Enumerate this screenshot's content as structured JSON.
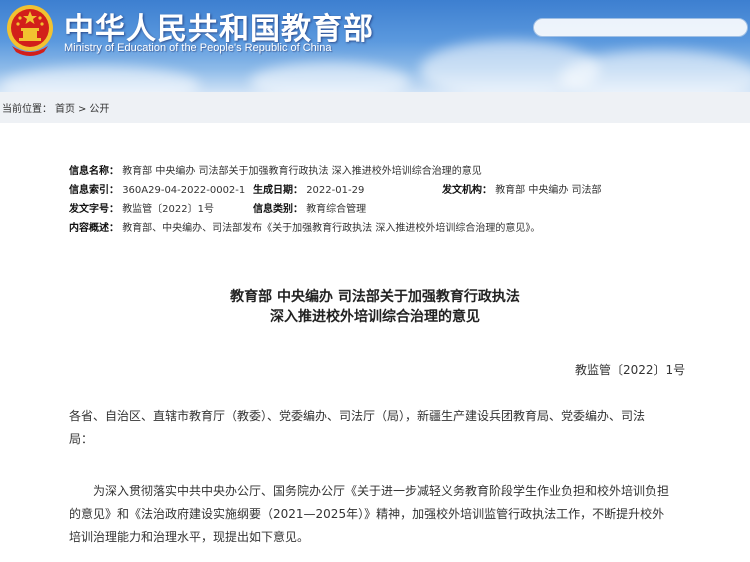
{
  "header": {
    "title": "中华人民共和国教育部",
    "subtitle": "Ministry of Education of the People's Republic of China",
    "search": {
      "placeholder": ""
    }
  },
  "breadcrumb": {
    "prefix": "当前位置：",
    "items": [
      "首页",
      "公开"
    ],
    "separator": ">"
  },
  "meta": {
    "name_label": "信息名称：",
    "name_value": "教育部 中央编办 司法部关于加强教育行政执法 深入推进校外培训综合治理的意见",
    "index_label": "信息索引：",
    "index_value": "360A29-04-2022-0002-1",
    "date_label": "生成日期：",
    "date_value": "2022-01-29",
    "issuer_label": "发文机构：",
    "issuer_value": "教育部 中央编办 司法部",
    "docno_label": "发文字号：",
    "docno_value": "教监管〔2022〕1号",
    "category_label": "信息类别：",
    "category_value": "教育综合管理",
    "summary_label": "内容概述：",
    "summary_value": "教育部、中央编办、司法部发布《关于加强教育行政执法 深入推进校外培训综合治理的意见》。"
  },
  "document": {
    "title_line1": "教育部 中央编办 司法部关于加强教育行政执法",
    "title_line2": "深入推进校外培训综合治理的意见",
    "number": "教监管〔2022〕1号",
    "addressee_line1": "各省、自治区、直辖市教育厅（教委）、党委编办、司法厅（局），新疆生产建设兵团教育局、党委编办、司法",
    "addressee_line2": "局：",
    "para1_line1": "为深入贯彻落实中共中央办公厅、国务院办公厅《关于进一步减轻义务教育阶段学生作业负担和校外培训负担",
    "para1_line2": "的意见》和《法治政府建设实施纲要（2021—2025年）》精神，加强校外培训监管行政执法工作，不断提升校外",
    "para1_line3": "培训治理能力和治理水平，现提出如下意见。"
  },
  "colors": {
    "banner_top": "#3d7fd0",
    "banner_bottom": "#cfe2f6",
    "emblem_red": "#d21f1a",
    "emblem_gold": "#f2c230"
  },
  "icons": {
    "emblem": "national-emblem-icon",
    "search": "search-box"
  }
}
